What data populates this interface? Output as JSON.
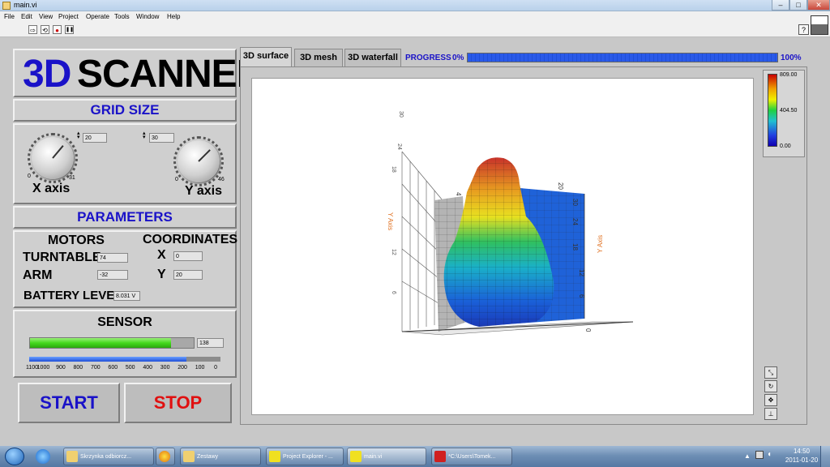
{
  "window": {
    "title": "main.vi"
  },
  "menu": [
    "File",
    "Edit",
    "View",
    "Project",
    "Operate",
    "Tools",
    "Window",
    "Help"
  ],
  "toolbar": {
    "run": "⇨",
    "run_continuous": "⟲",
    "abort": "●",
    "pause": "❚❚",
    "help": "?"
  },
  "app": {
    "title_3d": "3D",
    "title_scanner": "SCANNER",
    "grid_size_header": "GRID SIZE",
    "x_axis_label": "X axis",
    "y_axis_label": "Y axis",
    "x_value": "20",
    "y_value": "30",
    "x_knob_min": "0",
    "x_knob_max": "31",
    "y_knob_min": "0",
    "y_knob_max": "46",
    "parameters_header": "PARAMETERS",
    "motors_label": "MOTORS",
    "coordinates_label": "COORDINATES",
    "turntable_label": "TURNTABLE",
    "turntable_value": "74",
    "arm_label": "ARM",
    "arm_value": "-32",
    "coord_x_label": "X",
    "coord_x_value": "0",
    "coord_y_label": "Y",
    "coord_y_value": "20",
    "battery_label": "BATTERY LEVEL",
    "battery_value": "8.031 V",
    "sensor_header": "SENSOR",
    "sensor_value": "138",
    "sensor_level": 0.86,
    "sensor_slider_level": 0.82,
    "sensor_scale": [
      "1100",
      "1000",
      "900",
      "800",
      "700",
      "600",
      "500",
      "400",
      "300",
      "200",
      "100",
      "0"
    ],
    "start_label": "START",
    "stop_label": "STOP"
  },
  "tabs": [
    {
      "label": "3D surface",
      "active": true
    },
    {
      "label": "3D mesh",
      "active": false
    },
    {
      "label": "3D waterfall",
      "active": false
    }
  ],
  "progress": {
    "label": "PROGRESS",
    "min_label": "0%",
    "max_label": "100%",
    "value": 1.0
  },
  "plot": {
    "y_axis_title": "Y Axis",
    "y_axis_title_left": "Y Axis",
    "right_ticks": [
      "30",
      "24",
      "18",
      "12",
      "6",
      "0"
    ],
    "top_ticks": [
      "4",
      "20"
    ],
    "left_ticks": [
      "6",
      "12",
      "18",
      "24",
      "30"
    ],
    "colorbar_max": "809.00",
    "colorbar_mid": "404.50",
    "colorbar_min": "0.00"
  },
  "plot_tools": [
    "zoom-icon",
    "rotate-icon",
    "pan-icon",
    "axes-icon"
  ],
  "taskbar": {
    "items": [
      "Skrzynka odbiorcz...",
      "",
      "Zestawy",
      "Project Explorer - ...",
      "main.vi",
      "*C:\\Users\\Tomek..."
    ],
    "time": "14:50",
    "date": "2011-01-20"
  },
  "colors": {
    "header_blue": "#1a12c8",
    "start_blue": "#1a12c8",
    "stop_red": "#e01010",
    "progress_blue": "#1f4fd8",
    "sensor_green": "#44d81c"
  }
}
